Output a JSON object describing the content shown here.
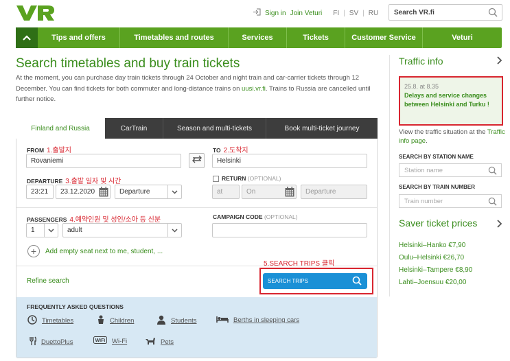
{
  "header": {
    "logo_text": "VR",
    "sign_in": "Sign in",
    "join": "Join Veturi",
    "languages": [
      "FI",
      "SV",
      "RU"
    ],
    "search_label": "Search VR.fi"
  },
  "nav": {
    "items": [
      "Tips and offers",
      "Timetables and routes",
      "Services",
      "Tickets",
      "Customer Service",
      "Veturi"
    ]
  },
  "main": {
    "title": "Search timetables and buy train tickets",
    "intro_before_link": "At the moment, you can purchase day train tickets through 24 October and night train and car-carrier tickets through 12 December. You can find tickets for both commuter and long-distance trains on ",
    "intro_link": "uusi.vr.fi",
    "intro_after_link": ". Trains to Russia are cancelled until further notice."
  },
  "tabs": [
    "Finland and Russia",
    "CarTrain",
    "Season and multi-tickets",
    "Book multi-ticket journey"
  ],
  "form": {
    "from_label": "FROM",
    "from_note": "1.출발지",
    "from_value": "Rovaniemi",
    "to_label": "TO",
    "to_note": "2.도착지",
    "to_value": "Helsinki",
    "departure_label": "DEPARTURE",
    "departure_note": "3.출발 일자 및 시간",
    "dep_time": "23:21",
    "dep_date": "23.12.2020",
    "dep_type": "Departure",
    "return_label": "RETURN",
    "return_optional": "(OPTIONAL)",
    "ret_at": "at",
    "ret_on": "On",
    "ret_type": "Departure",
    "passengers_label": "PASSENGERS",
    "passengers_note": "4.예약인원 및 성인/소아 등 신분",
    "pass_count": "1",
    "pass_type": "adult",
    "campaign_label": "CAMPAIGN CODE",
    "campaign_optional": "(OPTIONAL)",
    "add_seat": "Add empty seat next to me, student, ...",
    "search_note": "5.SEARCH TRIPS 클릭",
    "refine": "Refine search",
    "search_button": "SEARCH TRIPS"
  },
  "faq": {
    "title": "FREQUENTLY ASKED QUESTIONS",
    "row1": [
      {
        "icon": "clock-icon",
        "label": "Timetables"
      },
      {
        "icon": "child-icon",
        "label": "Children"
      },
      {
        "icon": "student-icon",
        "label": "Students"
      },
      {
        "icon": "bed-icon",
        "label": "Berths in sleeping cars"
      }
    ],
    "row2": [
      {
        "icon": "cutlery-icon",
        "label": "DuettoPlus"
      },
      {
        "icon": "wifi-icon",
        "label": "Wi-Fi"
      },
      {
        "icon": "dog-icon",
        "label": "Pets"
      }
    ]
  },
  "sidebar": {
    "traffic_title": "Traffic info",
    "alert_date": "25.8. at 8.35",
    "alert_text": "Delays and service changes between Helsinki and Turku !",
    "view_text": "View the traffic situation at the",
    "view_link": "Traffic info page",
    "view_end": ".",
    "station_label": "SEARCH BY STATION NAME",
    "station_placeholder": "Station name",
    "train_label": "SEARCH BY TRAIN NUMBER",
    "train_placeholder": "Train number",
    "saver_title": "Saver ticket prices",
    "saver": [
      "Helsinki–Hanko €7,90",
      "Oulu–Helsinki €26,70",
      "Helsinki–Tampere €8,90",
      "Lahti–Joensuu €20,00"
    ]
  },
  "colors": {
    "green": "#3a8d1d",
    "nav_green": "#5aa220",
    "red": "#d8252f",
    "blue": "#1a90d6"
  }
}
